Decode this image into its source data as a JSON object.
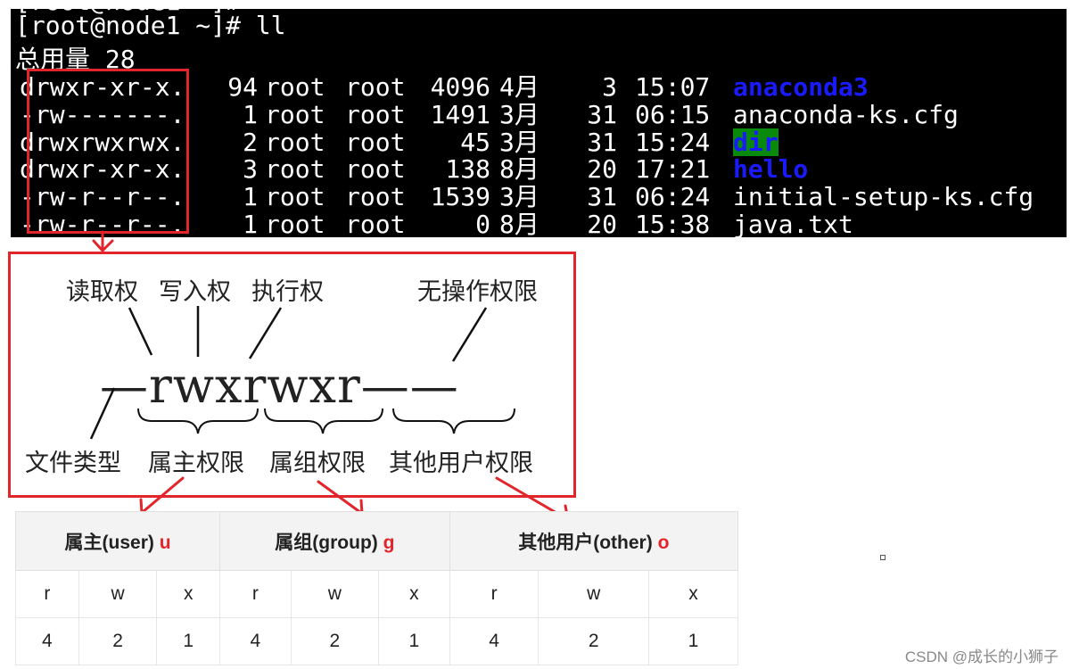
{
  "terminal": {
    "prompt": "[root@node1 ~]# ll",
    "total": "总用量 28",
    "entries": [
      {
        "perm": "drwxr-xr-x.",
        "links": "94",
        "owner": "root",
        "group": "root",
        "size": "4096",
        "month": "4月",
        "day": "3",
        "time": "15:07",
        "name": "anaconda3"
      },
      {
        "perm": "-rw-------.",
        "links": "1",
        "owner": "root",
        "group": "root",
        "size": "1491",
        "month": "3月",
        "day": "31",
        "time": "06:15",
        "name": "anaconda-ks.cfg"
      },
      {
        "perm": "drwxrwxrwx.",
        "links": "2",
        "owner": "root",
        "group": "root",
        "size": "45",
        "month": "3月",
        "day": "31",
        "time": "15:24",
        "name": "dir"
      },
      {
        "perm": "drwxr-xr-x.",
        "links": "3",
        "owner": "root",
        "group": "root",
        "size": "138",
        "month": "8月",
        "day": "20",
        "time": "17:21",
        "name": "hello"
      },
      {
        "perm": "-rw-r--r--.",
        "links": "1",
        "owner": "root",
        "group": "root",
        "size": "1539",
        "month": "3月",
        "day": "31",
        "time": "06:24",
        "name": "initial-setup-ks.cfg"
      },
      {
        "perm": "-rw-r--r--.",
        "links": "1",
        "owner": "root",
        "group": "root",
        "size": "0",
        "month": "8月",
        "day": "20",
        "time": "15:38",
        "name": "java.txt"
      }
    ]
  },
  "diagram": {
    "read": "读取权",
    "write": "写入权",
    "execute": "执行权",
    "none": "无操作权限",
    "perm_string": "—rwxrwxr——",
    "file_type": "文件类型",
    "owner_perm": "属主权限",
    "group_perm": "属组权限",
    "other_perm": "其他用户权限"
  },
  "table": {
    "headers": [
      {
        "text": "属主(user) ",
        "letter": "u"
      },
      {
        "text": "属组(group) ",
        "letter": "g"
      },
      {
        "text": "其他用户(other) ",
        "letter": "o"
      }
    ],
    "row_letters": [
      "r",
      "w",
      "x",
      "r",
      "w",
      "x",
      "r",
      "w",
      "x"
    ],
    "row_values": [
      "4",
      "2",
      "1",
      "4",
      "2",
      "1",
      "4",
      "2",
      "1"
    ]
  },
  "watermark": "CSDN @成长的小狮子",
  "colors": {
    "accent_red": "#e2242b",
    "dir_blue": "#1a1aff",
    "dir_green_bg": "#0a8a0a"
  }
}
